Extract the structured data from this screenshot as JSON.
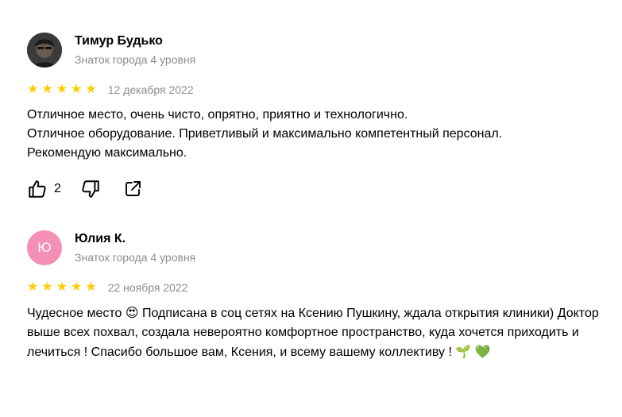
{
  "reviews": [
    {
      "author": "Тимур Будько",
      "level": "Знаток города 4 уровня",
      "rating": 5,
      "date": "12 декабря 2022",
      "text": "Отличное место, очень чисто, опрятно, приятно и технологично.\nОтличное оборудование. Приветливый и максимально компетентный персонал.\nРекомендую максимально.",
      "likes": "2",
      "avatar_icon": "user-photo"
    },
    {
      "author": "Юлия К.",
      "level": "Знаток города 4 уровня",
      "rating": 5,
      "date": "22 ноября 2022",
      "text_part1": "Чудесное место",
      "emoji1": "😍",
      "text_part2": " Подписана в соц сетях на Ксению Пушкину, ждала открытия клиники) Доктор выше всех похвал, создала невероятно комфортное пространство, куда хочется приходить и лечиться ! Спасибо большое вам, Ксения, и всему вашему коллективу ! ",
      "emoji2": "🌱",
      "emoji3": "💚",
      "avatar_letter": "Ю",
      "avatar_color": "#f490b5"
    }
  ],
  "colors": {
    "star": "#ffcc00",
    "muted": "#8c8c8c"
  },
  "icons": [
    "thumb-up-icon",
    "thumb-down-icon",
    "share-icon",
    "star-icon"
  ]
}
